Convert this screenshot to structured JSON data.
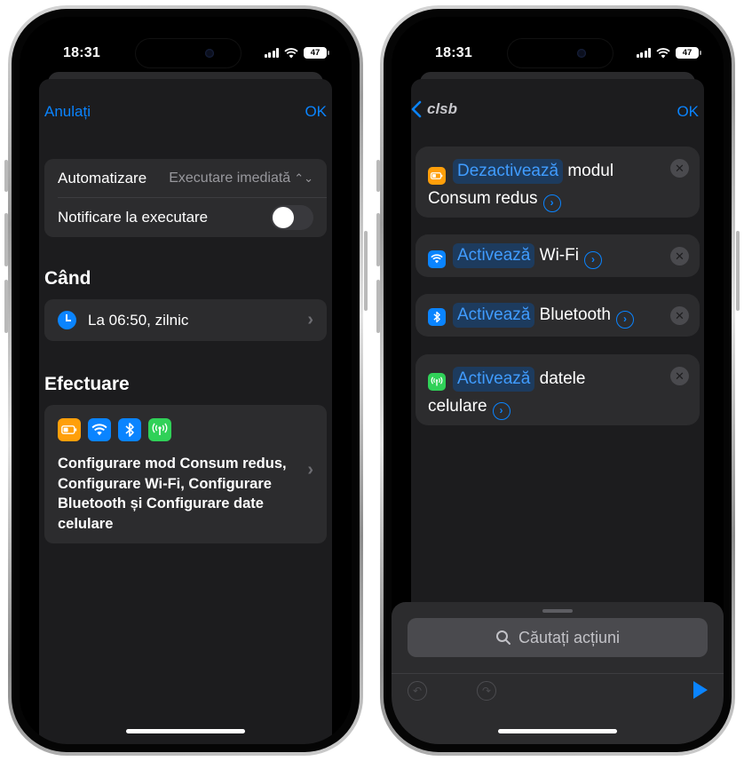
{
  "status": {
    "time": "18:31",
    "battery": "47"
  },
  "left": {
    "nav": {
      "cancel": "Anulați",
      "ok": "OK"
    },
    "settings": {
      "automation_label": "Automatizare",
      "automation_value": "Executare imediată",
      "notify_label": "Notificare la executare",
      "notify_on": false
    },
    "when": {
      "title": "Când",
      "schedule": "La 06:50, zilnic"
    },
    "perform": {
      "title": "Efectuare",
      "icons": [
        "low-power-battery-icon",
        "wifi-icon",
        "bluetooth-icon",
        "cellular-antenna-icon"
      ],
      "summary": "Configurare mod Consum redus, Configurare Wi-Fi, Configurare Bluetooth și Configurare date celulare"
    }
  },
  "right": {
    "nav": {
      "title": "clsb",
      "ok": "OK"
    },
    "actions": [
      {
        "icon": "low-power-battery-icon",
        "color": "#ff9f0a",
        "verb": "Dezactivează",
        "text_a": "modul",
        "text_b": "Consum redus"
      },
      {
        "icon": "wifi-icon",
        "color": "#0a84ff",
        "verb": "Activează",
        "text_a": "Wi-Fi"
      },
      {
        "icon": "bluetooth-icon",
        "color": "#0a84ff",
        "verb": "Activează",
        "text_a": "Bluetooth"
      },
      {
        "icon": "cellular-antenna-icon",
        "color": "#30d158",
        "verb": "Activează",
        "text_a": "datele",
        "text_b": "celulare"
      }
    ],
    "search_placeholder": "Căutați acțiuni"
  },
  "colors": {
    "accent": "#0a84ff",
    "battery_orange": "#ff9f0a",
    "cellular_green": "#30d158"
  }
}
